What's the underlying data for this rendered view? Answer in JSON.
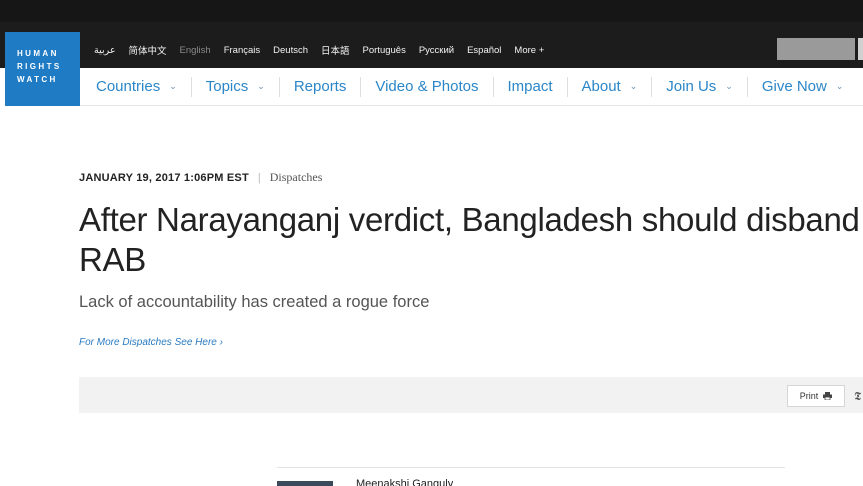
{
  "logo": {
    "lines": [
      "HUMAN",
      "RIGHTS",
      "WATCH"
    ]
  },
  "languages": [
    "عربية",
    "简体中文",
    "English",
    "Français",
    "Deutsch",
    "日本語",
    "Português",
    "Русский",
    "Español",
    "More +"
  ],
  "nav": [
    {
      "label": "Countries",
      "dropdown": true
    },
    {
      "label": "Topics",
      "dropdown": true
    },
    {
      "label": "Reports",
      "dropdown": false
    },
    {
      "label": "Video & Photos",
      "dropdown": false
    },
    {
      "label": "Impact",
      "dropdown": false
    },
    {
      "label": "About",
      "dropdown": true
    },
    {
      "label": "Join Us",
      "dropdown": true
    },
    {
      "label": "Give Now",
      "dropdown": true
    }
  ],
  "article": {
    "date": "JANUARY 19, 2017 1:06PM EST",
    "separator": "|",
    "category": "Dispatches",
    "headline": "After Narayanganj verdict, Bangladesh should disband RAB",
    "subtitle": "Lack of accountability has created a rogue force",
    "more_link": "For More Dispatches See Here ›"
  },
  "share": {
    "print_label": "Print",
    "print_icon": "printer-icon",
    "twitter_icon": "twitter-icon"
  },
  "author": {
    "name": "Meenakshi Ganguly"
  },
  "colors": {
    "brand_blue": "#1f7bc4",
    "link_blue": "#2a86c8",
    "dark_bar": "#1c1c1c"
  }
}
